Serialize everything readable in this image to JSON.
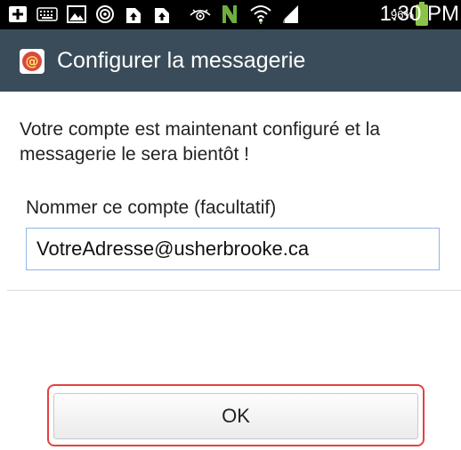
{
  "status_bar": {
    "time": "1:30 PM",
    "battery": "96%",
    "icons": [
      "add-box-icon",
      "keyboard-icon",
      "image-icon",
      "nfc-target-icon",
      "upload-icon",
      "upload-icon",
      "eye-icon",
      "nfc-n-icon",
      "wifi-icon",
      "signal-icon",
      "battery-icon"
    ],
    "colors": {
      "background": "#000000",
      "battery": "#8bc34a"
    }
  },
  "action_bar": {
    "title": "Configurer la messagerie",
    "icon": "email-app-icon",
    "background": "#3a4c59"
  },
  "content": {
    "message": "Votre compte est maintenant configuré et la messagerie le sera bientôt !",
    "account_name_label": "Nommer ce compte (facultatif)",
    "account_name_value": "VotreAdresse@usherbrooke.ca"
  },
  "footer": {
    "ok_label": "OK",
    "highlight_color": "#e5413f"
  }
}
